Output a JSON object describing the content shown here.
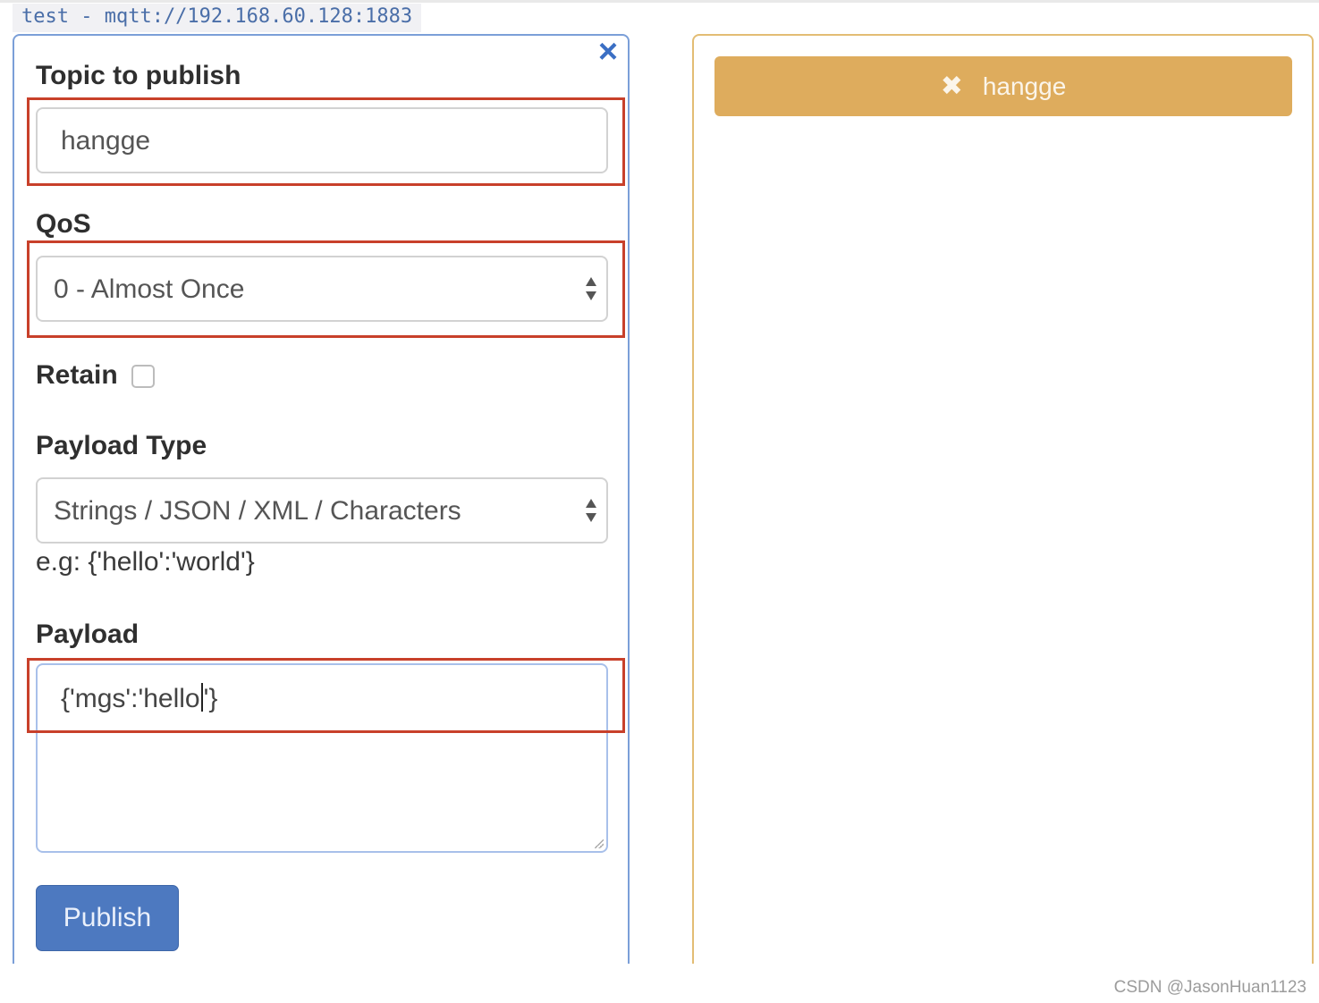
{
  "connection": {
    "label": "test - mqtt://192.168.60.128:1883"
  },
  "publish_panel": {
    "close_icon": "×",
    "topic": {
      "label": "Topic to publish",
      "value": "hangge"
    },
    "qos": {
      "label": "QoS",
      "selected": "0 - Almost Once"
    },
    "retain": {
      "label": "Retain",
      "checked": false
    },
    "payload_type": {
      "label": "Payload Type",
      "selected": "Strings / JSON / XML / Characters",
      "hint": "e.g: {'hello':'world'}"
    },
    "payload": {
      "label": "Payload",
      "value_before_caret": "{'mgs':'hello",
      "value_after_caret": "'}"
    },
    "publish_button": "Publish"
  },
  "subscriptions": {
    "chip_icon": "✖",
    "chip_label": "hangge",
    "chip_color": "#deac5d"
  },
  "watermark": "CSDN @JasonHuan1123",
  "colors": {
    "highlight_box": "#c8402a",
    "publish_panel_border": "#7b9fd8",
    "subscription_panel_border": "#e3bd74",
    "button_primary": "#4d79c0"
  }
}
